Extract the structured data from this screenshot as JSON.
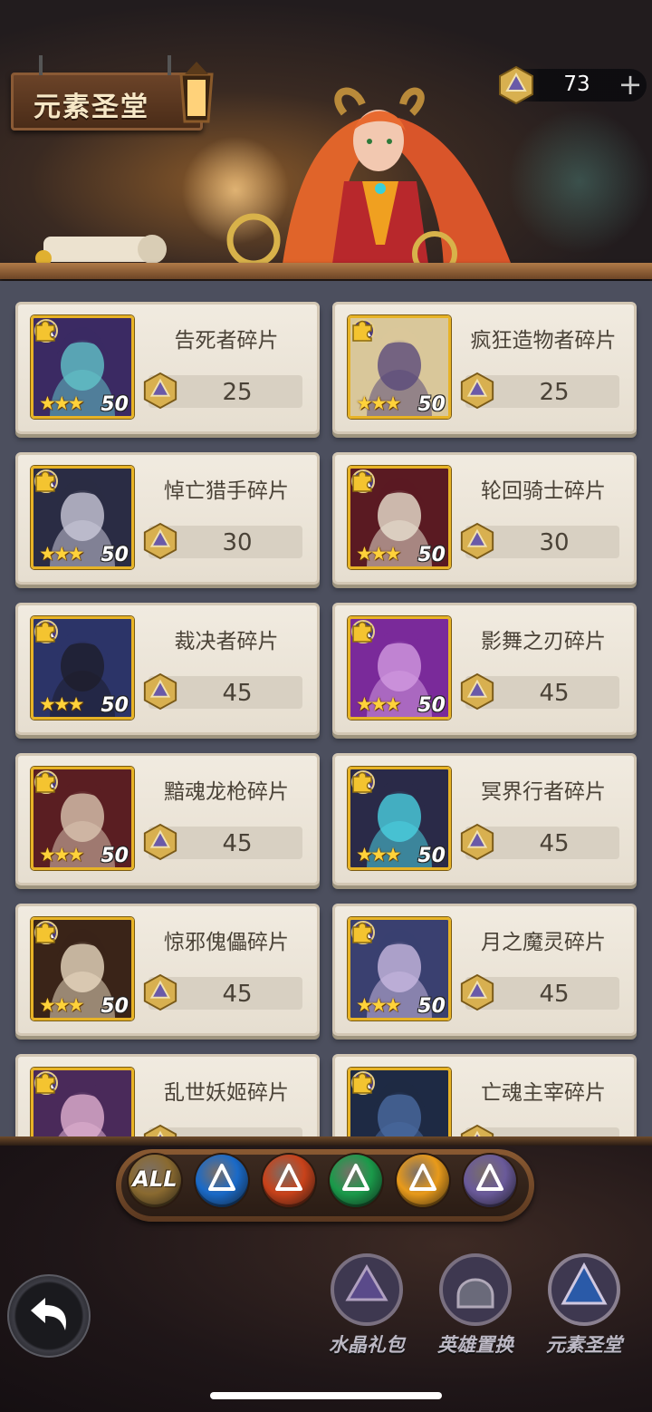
{
  "header": {
    "title": "元素圣堂",
    "currency": {
      "icon": "crystal-icon",
      "value": "73",
      "add_label": "+"
    }
  },
  "shop_items": [
    {
      "name": "告死者碎片",
      "price": "25",
      "stars": "★★★",
      "level": "50",
      "colors": [
        "#3b2a63",
        "#62c3c8"
      ]
    },
    {
      "name": "疯狂造物者碎片",
      "price": "25",
      "stars": "★★★",
      "level": "50",
      "colors": [
        "#d9c79a",
        "#5a4a7a"
      ]
    },
    {
      "name": "悼亡猎手碎片",
      "price": "30",
      "stars": "★★★",
      "level": "50",
      "colors": [
        "#2a2c44",
        "#c9c8d8"
      ]
    },
    {
      "name": "轮回骑士碎片",
      "price": "30",
      "stars": "★★★",
      "level": "50",
      "colors": [
        "#5a1a22",
        "#e8e0d0"
      ]
    },
    {
      "name": "裁决者碎片",
      "price": "45",
      "stars": "★★★",
      "level": "50",
      "colors": [
        "#2c3468",
        "#1e1e2a"
      ]
    },
    {
      "name": "影舞之刃碎片",
      "price": "45",
      "stars": "★★★",
      "level": "50",
      "colors": [
        "#7a2a9a",
        "#d29ae0"
      ]
    },
    {
      "name": "黯魂龙枪碎片",
      "price": "45",
      "stars": "★★★",
      "level": "50",
      "colors": [
        "#5a1e22",
        "#d9c4b0"
      ]
    },
    {
      "name": "冥界行者碎片",
      "price": "45",
      "stars": "★★★",
      "level": "50",
      "colors": [
        "#2a2a48",
        "#4ad0e0"
      ]
    },
    {
      "name": "惊邪傀儡碎片",
      "price": "45",
      "stars": "★★★",
      "level": "50",
      "colors": [
        "#3a2418",
        "#e8d8c0"
      ]
    },
    {
      "name": "月之魔灵碎片",
      "price": "45",
      "stars": "★★★",
      "level": "50",
      "colors": [
        "#3a4070",
        "#c8b8e0"
      ]
    },
    {
      "name": "乱世妖姬碎片",
      "price": "",
      "stars": "",
      "level": "",
      "colors": [
        "#4a2a5a",
        "#e0b0d0"
      ]
    },
    {
      "name": "亡魂主宰碎片",
      "price": "",
      "stars": "",
      "level": "",
      "colors": [
        "#1e2a44",
        "#4a6aa0"
      ]
    }
  ],
  "filters": [
    {
      "id": "all",
      "label": "ALL",
      "icon": "all-filter-icon",
      "color": "#8a6a30"
    },
    {
      "id": "water",
      "label": "",
      "icon": "water-element-icon",
      "color": "#1a6ac8"
    },
    {
      "id": "fire",
      "label": "",
      "icon": "fire-element-icon",
      "color": "#c8421a"
    },
    {
      "id": "wind",
      "label": "",
      "icon": "wind-element-icon",
      "color": "#1a9a4a"
    },
    {
      "id": "light",
      "label": "",
      "icon": "light-element-icon",
      "color": "#e89a1a"
    },
    {
      "id": "dark",
      "label": "",
      "icon": "dark-element-icon",
      "color": "#6a5a9a"
    }
  ],
  "bottom_nav": [
    {
      "label": "水晶礼包",
      "icon": "crystal-gift-icon"
    },
    {
      "label": "英雄置换",
      "icon": "hero-swap-icon"
    },
    {
      "label": "元素圣堂",
      "icon": "element-temple-icon"
    }
  ],
  "back_icon": "back-arrow-icon"
}
